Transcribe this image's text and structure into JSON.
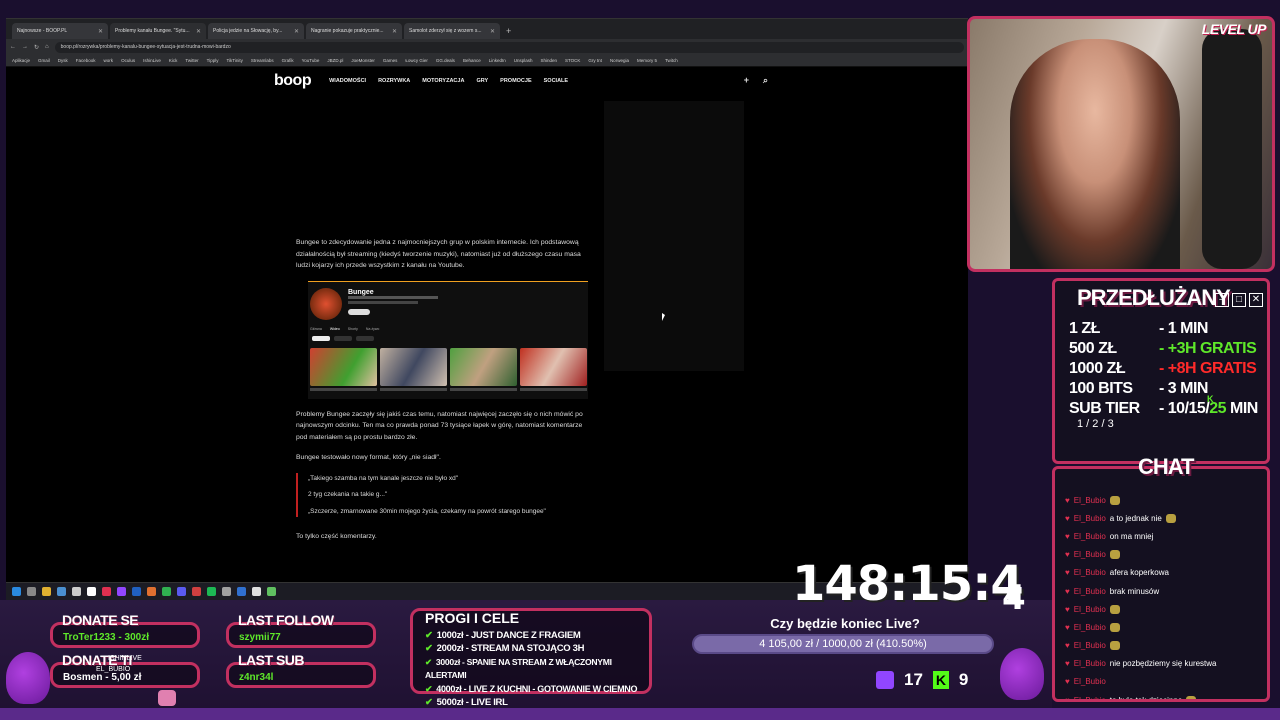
{
  "browser": {
    "tabs": [
      {
        "label": "Najnowsze - BOOP.PL"
      },
      {
        "label": "Problemy kanału Bungee. \"Sytu..."
      },
      {
        "label": "Policja jedzie na Słowację, by..."
      },
      {
        "label": "Nagranie pokazuje praktycznie..."
      },
      {
        "label": "Samolot zderzył się z wozem s..."
      }
    ],
    "url": "boop.pl/rozrywka/problemy-kanalu-bungee-sytuacja-jest-trudna-mowi-bardzo",
    "bookmarks": [
      "Aplikacje",
      "Gmail",
      "Dysk",
      "Facebook",
      "work",
      "Oculus",
      "IshinLive",
      "Kick",
      "Twitter",
      "Tipply",
      "TikTinity",
      "Streamlabs",
      "Grafik",
      "YouTube",
      "JBZD.pl",
      "JoeMonster",
      "Games",
      "Łowcy Gier",
      "GG.deals",
      "Behance",
      "LinkedIn",
      "Unsplash",
      "Shinden",
      "STOCK",
      "Gry tnt",
      "Norwegia",
      "Memory 5",
      "Twitch"
    ]
  },
  "site": {
    "logo": "boop",
    "nav": [
      "WIADOMOŚCI",
      "ROZRYWKA",
      "MOTORYZACJA",
      "GRY",
      "PROMOCJE",
      "SOCIALE"
    ],
    "plus_icon": "+",
    "search_icon": "⌕"
  },
  "article": {
    "p1": "Bungee to zdecydowanie jedna z najmocniejszych grup w polskim internecie. Ich podstawową działalnością był streaming (kiedyś tworzenie muzyki), natomiast już od dłuższego czasu masa ludzi kojarzy ich przede wszystkim z kanału na Youtube.",
    "yt_channel": "Bungee",
    "yt_tabs": [
      "Główna",
      "Wideo",
      "Shorty",
      "Na żywo"
    ],
    "p2": "Problemy Bungee zaczęły się jakiś czas temu, natomiast najwięcej zaczęło się o nich mówić po najnowszym odcinku. Ten ma co prawda ponad 73 tysiące łapek w górę, natomiast komentarze pod materiałem są po prostu bardzo złe.",
    "p3": "Bungee testowało nowy format, który „nie siadł\".",
    "quotes": [
      "„Takiego szamba na tym kanale jeszcze nie było xd\"",
      "2 tyg czekania na takie g...\"",
      "„Szczerze, zmarnowane 30min mojego życia, czekamy na powrót starego bungee\""
    ],
    "p4": "To tylko część komentarzy."
  },
  "overlay": {
    "webcam_logo": "LEVEL UP",
    "przed": {
      "title": "PRZEDŁUŻANY",
      "rows": [
        {
          "k": "1 ZŁ",
          "v": "- 1 MIN"
        },
        {
          "k": "500 ZŁ",
          "v": "- +3H GRATIS"
        },
        {
          "k": "1000 ZŁ",
          "v": "- +8H GRATIS"
        },
        {
          "k": "100 BITS",
          "v": "- 3 MIN"
        },
        {
          "k": "SUB TIER",
          "v": "- 10/15/25 MIN"
        }
      ],
      "subtier_sub": "1 / 2 / 3",
      "k_label": "K",
      "tier_prefix": "- 10/15/",
      "tier_highlight": "25",
      "tier_suffix": " MIN"
    },
    "chat": {
      "title": "CHAT",
      "messages": [
        {
          "user": "El_Bubio",
          "text": "",
          "emote": true
        },
        {
          "user": "El_Bubio",
          "text": "a to jednak nie",
          "emote": true
        },
        {
          "user": "El_Bubio",
          "text": "on ma mniej",
          "emote": false
        },
        {
          "user": "El_Bubio",
          "text": "",
          "emote": true
        },
        {
          "user": "El_Bubio",
          "text": "afera koperkowa",
          "emote": false
        },
        {
          "user": "El_Bubio",
          "text": "brak minusów",
          "emote": false
        },
        {
          "user": "El_Bubio",
          "text": "",
          "emote": true
        },
        {
          "user": "El_Bubio",
          "text": "",
          "emote": true
        },
        {
          "user": "El_Bubio",
          "text": "",
          "emote": true
        },
        {
          "user": "El_Bubio",
          "text": "nie pozbędziemy się kurestwa",
          "emote": false
        },
        {
          "user": "El_Bubio",
          "text": "",
          "emote": false
        },
        {
          "user": "El_Bubio",
          "text": "to było tak dziecinne",
          "emote": true
        }
      ]
    },
    "donate_se": {
      "title": "DONATE SE",
      "value": "TroTer1233 - 300zł"
    },
    "donate_ti": {
      "title": "DONATE TI",
      "value": "Bosmen - 5,00 zł",
      "overlay_name": "ISHINLIVE",
      "overlay_name2": "EL_BUBIO"
    },
    "last_follow": {
      "title": "LAST FOLLOW",
      "value": "szymii77"
    },
    "last_sub": {
      "title": "LAST SUB",
      "value": "z4nr34l"
    },
    "progi": {
      "title": "PROGI I CELE",
      "items": [
        "1000zł - JUST DANCE Z FRAGIEM",
        "2000zł - STREAM NA STOJĄCO 3H",
        "3000zł - SPANIE NA STREAM Z WŁĄCZONYMI ALERTAMI",
        "4000zł - LIVE Z KUCHNI - GOTOWANIE W CIEMNO",
        "5000zł - LIVE IRL"
      ]
    },
    "goal": {
      "title": "Czy będzie koniec Live?",
      "text": "4 105,00 zł / 1000,00 zł (410.50%)"
    },
    "timer": "148:15:4",
    "timer_last": "4",
    "twitch_count": "17",
    "kick_count": "9",
    "colors": {
      "accent": "#c23060",
      "green": "#5ee82a",
      "red": "#ff2a2a",
      "twitch": "#9146ff",
      "kick": "#53fc18"
    }
  }
}
